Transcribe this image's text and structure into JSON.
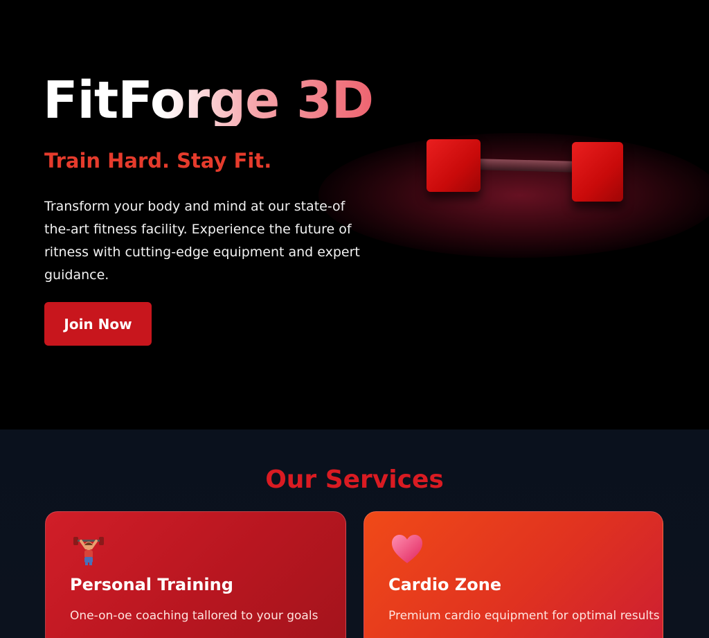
{
  "hero": {
    "title": "FitForge 3D",
    "tagline": "Train Hard. Stay Fit.",
    "description": "Transform your body and mind at our  state-of the-art fitness facility. Experience the future of ritness with cutting-edge equipment and expert guidance.",
    "cta_label": "Join Now"
  },
  "services": {
    "title": "Our Services",
    "items": [
      {
        "icon": "weightlifter-icon",
        "title": "Personal Training",
        "description": "One-on-oe coaching tallored to your goals"
      },
      {
        "icon": "heart-icon",
        "title": "Cardio Zone",
        "description": "Premium cardio equipment for optimal results"
      }
    ]
  },
  "colors": {
    "accent": "#d91b22",
    "tagline": "#e53b2c",
    "background": "#000000",
    "services_background": "#0a111d",
    "card_training": "#c41a24",
    "card_cardio": "#e83a1c"
  }
}
